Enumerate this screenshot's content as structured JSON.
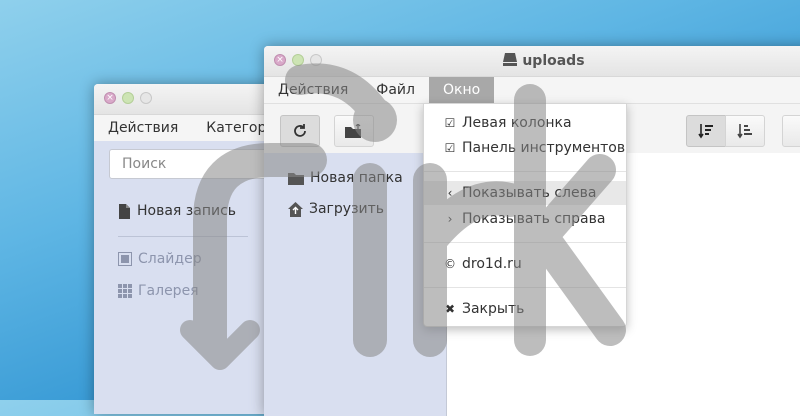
{
  "back_window": {
    "menu": [
      "Действия",
      "Категори"
    ],
    "search_placeholder": "Поиск",
    "new_entry": "Новая запись",
    "slider": "Слайдер",
    "gallery": "Галерея"
  },
  "front_window": {
    "title": "uploads",
    "menu": [
      "Действия",
      "Файл",
      "Окно"
    ],
    "active_menu": "Окно",
    "new_folder": "Новая папка",
    "upload": "Загрузить"
  },
  "dropdown": {
    "items": [
      {
        "label": "Левая колонка",
        "icon": "checkbox-checked-icon"
      },
      {
        "label": "Панель инструментов",
        "icon": "checkbox-checked-icon"
      },
      {
        "label": "Показывать слева",
        "icon": "chevron-left-icon"
      },
      {
        "label": "Показывать справа",
        "icon": "chevron-right-icon"
      },
      {
        "label": "dro1d.ru",
        "icon": "copyright-icon"
      },
      {
        "label": "Закрыть",
        "icon": "close-circle-icon"
      }
    ]
  },
  "colors": {
    "sidebar": "#d9dff0",
    "menu_active": "#a8a8a8"
  }
}
